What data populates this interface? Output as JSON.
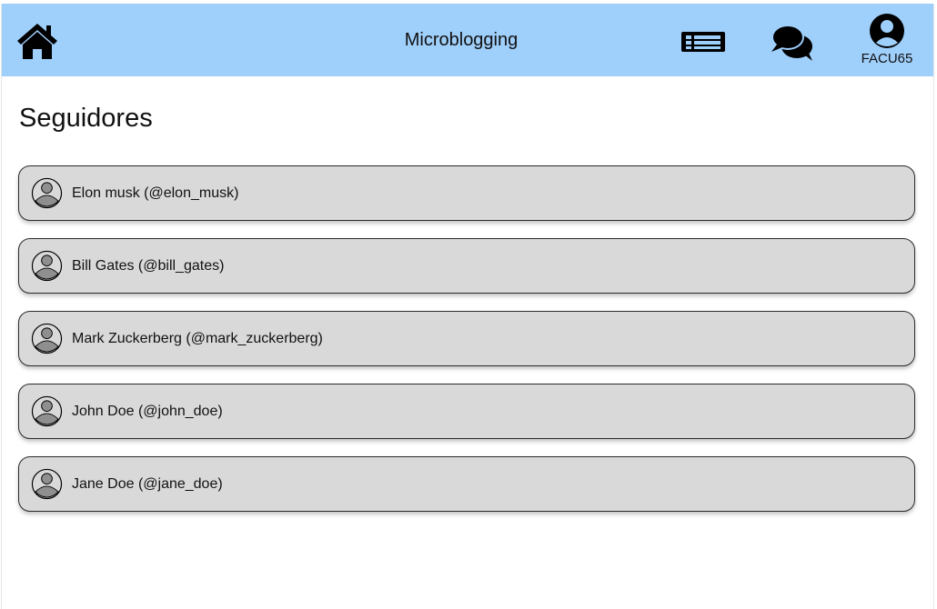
{
  "header": {
    "title": "Microblogging",
    "home_icon": "home-icon",
    "feed_icon": "feed-icon",
    "chat_icon": "chat-icon",
    "user_icon": "user-circle-icon",
    "username": "FACU65",
    "background_color": "#9fcffb"
  },
  "main": {
    "title": "Seguidores",
    "followers": [
      {
        "label": "Elon musk (@elon_musk)",
        "icon": "avatar-icon"
      },
      {
        "label": "Bill Gates (@bill_gates)",
        "icon": "avatar-icon"
      },
      {
        "label": "Mark Zuckerberg (@mark_zuckerberg)",
        "icon": "avatar-icon"
      },
      {
        "label": "John Doe (@john_doe)",
        "icon": "avatar-icon"
      },
      {
        "label": "Jane Doe (@jane_doe)",
        "icon": "avatar-icon"
      }
    ]
  },
  "colors": {
    "card_background": "#d9d9d9",
    "card_border": "#2b2b2b",
    "avatar_fill": "#8f8f8f"
  }
}
